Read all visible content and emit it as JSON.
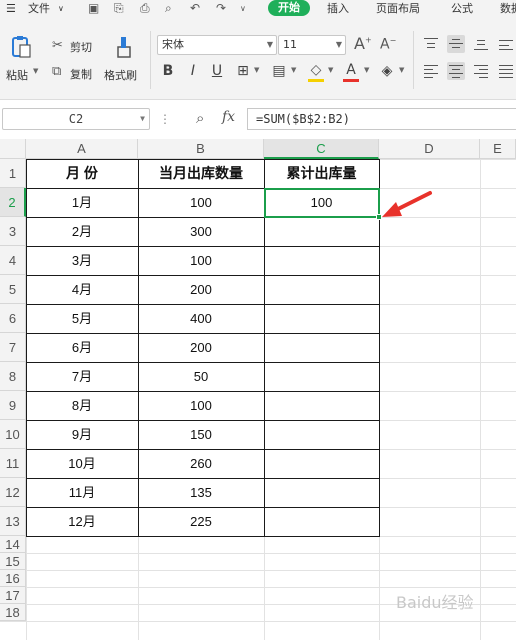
{
  "menubar": {
    "file": "文件",
    "tabs": [
      "开始",
      "插入",
      "页面布局",
      "公式",
      "数据"
    ]
  },
  "ribbon": {
    "paste": "粘贴",
    "cut": "剪切",
    "copy": "复制",
    "format_painter": "格式刷",
    "font_name": "宋体",
    "font_size": "11"
  },
  "formula_bar": {
    "name_box": "C2",
    "fx": "fx",
    "formula": "=SUM($B$2:B2)"
  },
  "sheet": {
    "columns": [
      "A",
      "B",
      "C",
      "D",
      "E"
    ],
    "rows": [
      "1",
      "2",
      "3",
      "4",
      "5",
      "6",
      "7",
      "8",
      "9",
      "10",
      "11",
      "12",
      "13",
      "14",
      "15",
      "16",
      "17",
      "18"
    ],
    "headers": [
      "月  份",
      "当月出库数量",
      "累计出库量"
    ],
    "data": [
      [
        "1月",
        "100",
        "100"
      ],
      [
        "2月",
        "300",
        ""
      ],
      [
        "3月",
        "100",
        ""
      ],
      [
        "4月",
        "200",
        ""
      ],
      [
        "5月",
        "400",
        ""
      ],
      [
        "6月",
        "200",
        ""
      ],
      [
        "7月",
        "50",
        ""
      ],
      [
        "8月",
        "100",
        ""
      ],
      [
        "9月",
        "150",
        ""
      ],
      [
        "10月",
        "260",
        ""
      ],
      [
        "11月",
        "135",
        ""
      ],
      [
        "12月",
        "225",
        ""
      ]
    ]
  },
  "accent_green": "#1faf5a",
  "arrow_color": "#e8322b",
  "watermark": "Baidu经验"
}
